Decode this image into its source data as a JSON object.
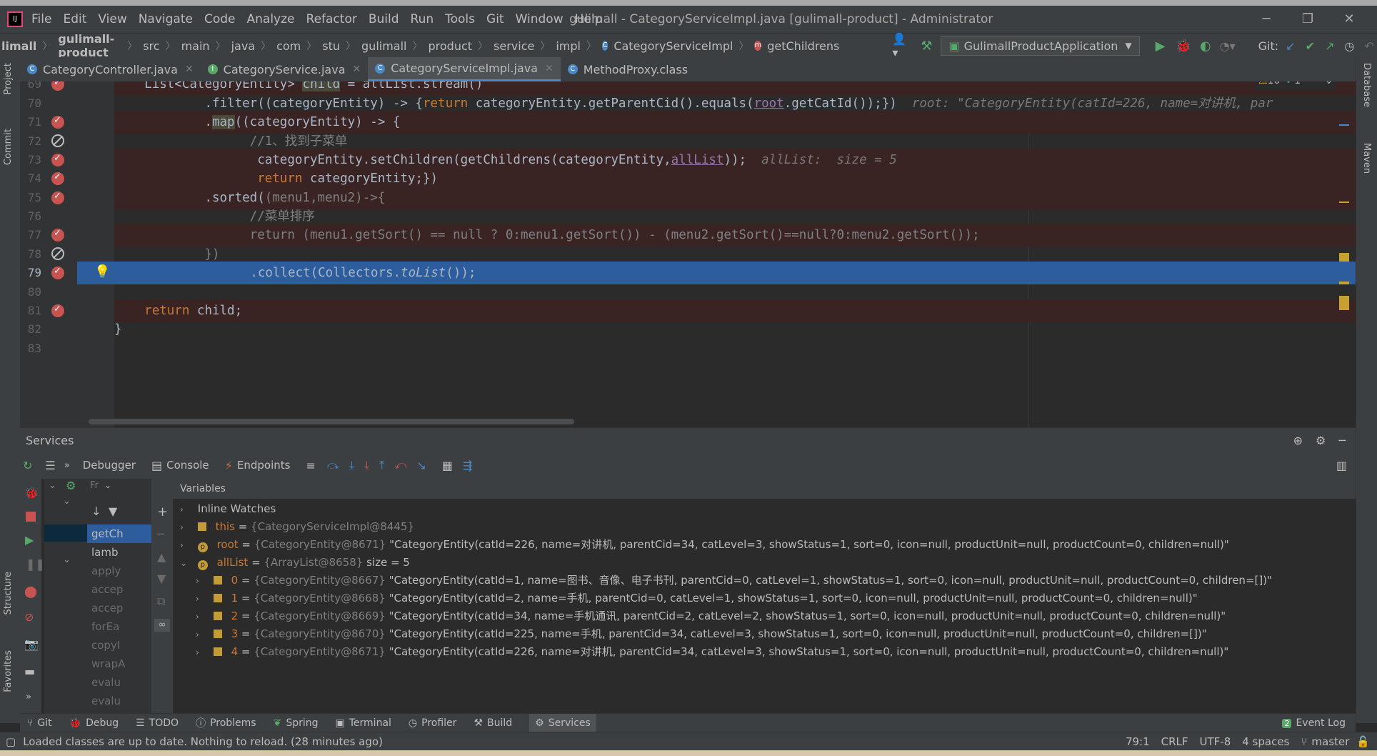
{
  "window": {
    "title": "gulimall - CategoryServiceImpl.java [gulimall-product] - Administrator"
  },
  "menu": [
    "File",
    "Edit",
    "View",
    "Navigate",
    "Code",
    "Analyze",
    "Refactor",
    "Build",
    "Run",
    "Tools",
    "Git",
    "Window",
    "Help"
  ],
  "breadcrumb": [
    "limall",
    "gulimall-product",
    "src",
    "main",
    "java",
    "com",
    "stu",
    "gulimall",
    "product",
    "service",
    "impl",
    "CategoryServiceImpl",
    "getChildrens"
  ],
  "run_config": "GulimallProductApplication",
  "git_label": "Git:",
  "tabs": [
    {
      "label": "CategoryController.java",
      "active": false
    },
    {
      "label": "CategoryService.java",
      "active": false
    },
    {
      "label": "CategoryServiceImpl.java",
      "active": true
    },
    {
      "label": "MethodProxy.class",
      "active": false
    }
  ],
  "left_strip": {
    "project": "Project",
    "commit": "Commit",
    "structure": "Structure",
    "favorites": "Favorites"
  },
  "right_strip": {
    "database": "Database",
    "maven": "Maven"
  },
  "editor": {
    "inspection": {
      "warnings": "10",
      "ok": "1"
    },
    "lines": [
      {
        "num": "69",
        "bp": "on"
      },
      {
        "num": "70",
        "bp": "none"
      },
      {
        "num": "71",
        "bp": "on"
      },
      {
        "num": "72",
        "bp": "off"
      },
      {
        "num": "73",
        "bp": "on"
      },
      {
        "num": "74",
        "bp": "on"
      },
      {
        "num": "75",
        "bp": "on"
      },
      {
        "num": "76",
        "bp": "none"
      },
      {
        "num": "77",
        "bp": "on"
      },
      {
        "num": "78",
        "bp": "off"
      },
      {
        "num": "79",
        "bp": "on"
      },
      {
        "num": "80",
        "bp": "none"
      },
      {
        "num": "81",
        "bp": "on"
      },
      {
        "num": "82",
        "bp": "none"
      },
      {
        "num": "83",
        "bp": "none"
      }
    ],
    "code": {
      "l69_a": "List<CategoryEntity> ",
      "l69_b": "child",
      "l69_c": " = allList.stream()",
      "l70_a": ".filter((categoryEntity) -> {",
      "l70_b": "return",
      "l70_c": " categoryEntity.getParentCid().equals(",
      "l70_d": "root",
      "l70_e": ".getCatId());})",
      "l70_hint": "root: \"CategoryEntity(catId=226, name=对讲机, par",
      "l71_a": ".",
      "l71_b": "map",
      "l71_c": "((categoryEntity) -> {",
      "l72": "//1、找到子菜单",
      "l73_a": "categoryEntity.setChildren(getChildrens(categoryEntity,",
      "l73_b": "allList",
      "l73_c": "));",
      "l73_hint": "allList:  size = 5",
      "l74_a": "return",
      "l74_b": " categoryEntity;})",
      "l75_a": ".sorted(",
      "l75_b": "(menu1,menu2)->{",
      "l76": "//菜单排序",
      "l77": "return (menu1.getSort() == null ? 0:menu1.getSort()) - (menu2.getSort()==null?0:menu2.getSort());",
      "l78": "})",
      "l79_a": ".collect(Collectors.",
      "l79_b": "toList",
      "l79_c": "());",
      "l81_a": "return",
      "l81_b": " child;",
      "l82": "}"
    }
  },
  "services": {
    "title": "Services",
    "tabs": {
      "debugger": "Debugger",
      "console": "Console",
      "endpoints": "Endpoints"
    },
    "frames_label": "Fr",
    "variables_label": "Variables",
    "frames": [
      "getCh",
      "lamb",
      "apply",
      "accep",
      "accep",
      "forEa",
      "copyI",
      "wrapA",
      "evalu",
      "evalu"
    ],
    "inline_watches": "Inline Watches",
    "vars": [
      {
        "name": "this",
        "type": "{CategoryServiceImpl@8445}",
        "value": ""
      },
      {
        "name": "root",
        "type": "{CategoryEntity@8671}",
        "value": "\"CategoryEntity(catId=226, name=对讲机, parentCid=34, catLevel=3, showStatus=1, sort=0, icon=null, productUnit=null, productCount=0, children=null)\""
      },
      {
        "name": "allList",
        "type": "{ArrayList@8658}",
        "value": "size = 5"
      }
    ],
    "items": [
      {
        "idx": "0",
        "type": "{CategoryEntity@8667}",
        "value": "\"CategoryEntity(catId=1, name=图书、音像、电子书刊, parentCid=0, catLevel=1, showStatus=1, sort=0, icon=null, productUnit=null, productCount=0, children=[])\""
      },
      {
        "idx": "1",
        "type": "{CategoryEntity@8668}",
        "value": "\"CategoryEntity(catId=2, name=手机, parentCid=0, catLevel=1, showStatus=1, sort=0, icon=null, productUnit=null, productCount=0, children=null)\""
      },
      {
        "idx": "2",
        "type": "{CategoryEntity@8669}",
        "value": "\"CategoryEntity(catId=34, name=手机通讯, parentCid=2, catLevel=2, showStatus=1, sort=0, icon=null, productUnit=null, productCount=0, children=null)\""
      },
      {
        "idx": "3",
        "type": "{CategoryEntity@8670}",
        "value": "\"CategoryEntity(catId=225, name=手机, parentCid=34, catLevel=3, showStatus=1, sort=0, icon=null, productUnit=null, productCount=0, children=[])\""
      },
      {
        "idx": "4",
        "type": "{CategoryEntity@8671}",
        "value": "\"CategoryEntity(catId=226, name=对讲机, parentCid=34, catLevel=3, showStatus=1, sort=0, icon=null, productUnit=null, productCount=0, children=null)\""
      }
    ]
  },
  "bottom_tabs": [
    {
      "label": "Git",
      "active": false
    },
    {
      "label": "Debug",
      "active": false
    },
    {
      "label": "TODO",
      "active": false
    },
    {
      "label": "Problems",
      "active": false
    },
    {
      "label": "Spring",
      "active": false
    },
    {
      "label": "Terminal",
      "active": false
    },
    {
      "label": "Profiler",
      "active": false
    },
    {
      "label": "Build",
      "active": false
    },
    {
      "label": "Services",
      "active": true
    }
  ],
  "event_log": {
    "count": "2",
    "label": "Event Log"
  },
  "status": {
    "message": "Loaded classes are up to date. Nothing to reload. (28 minutes ago)",
    "position": "79:1",
    "line_sep": "CRLF",
    "encoding": "UTF-8",
    "indent": "4 spaces",
    "branch": "master"
  }
}
